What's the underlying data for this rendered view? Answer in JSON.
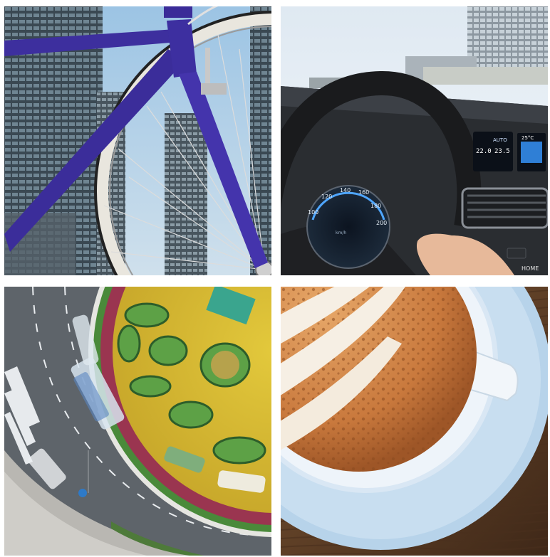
{
  "dashboard": {
    "climate_mode": "AUTO",
    "temp_left": "22.0",
    "temp_right": "23.5",
    "outside_temp": "25°C",
    "home_label": "HOME"
  },
  "speedometer": {
    "ticks": [
      "100",
      "120",
      "140",
      "160",
      "180",
      "200"
    ],
    "unit": "km/h"
  }
}
